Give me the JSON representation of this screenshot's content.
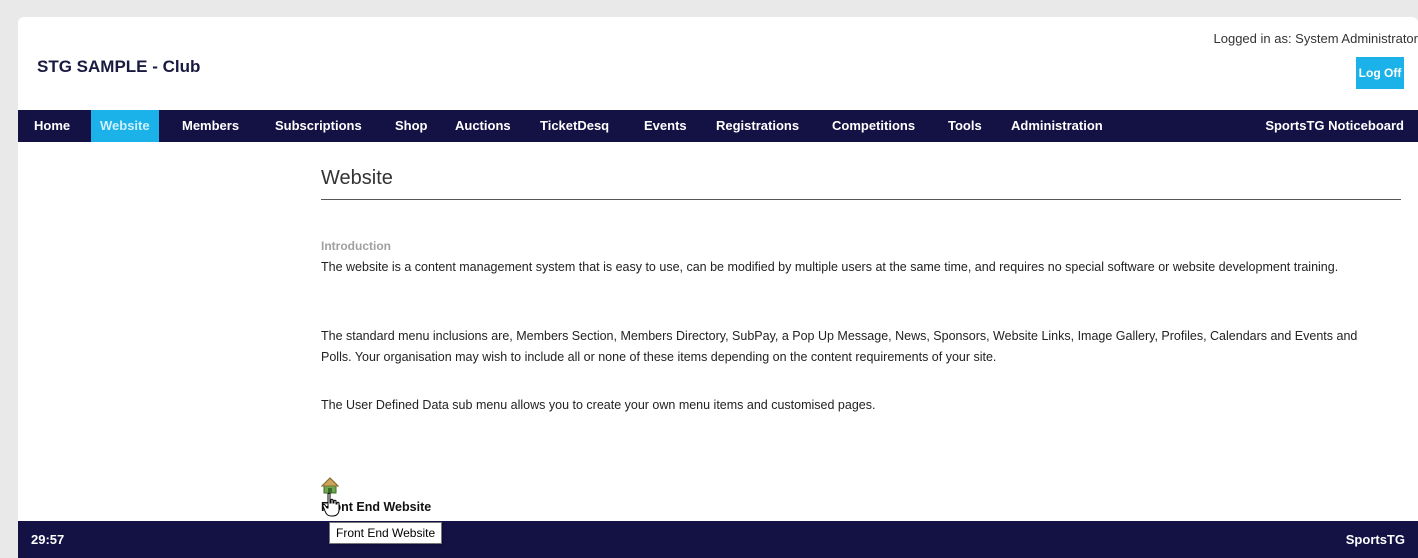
{
  "header": {
    "brand": "STG SAMPLE - Club",
    "login_info": "Logged in as: System Administrator",
    "logoff_label": "Log Off"
  },
  "nav": {
    "items": [
      {
        "label": "Home"
      },
      {
        "label": "Website",
        "active": true
      },
      {
        "label": "Members"
      },
      {
        "label": "Subscriptions"
      },
      {
        "label": "Shop"
      },
      {
        "label": "Auctions"
      },
      {
        "label": "TicketDesq"
      },
      {
        "label": "Events"
      },
      {
        "label": "Registrations"
      },
      {
        "label": "Competitions"
      },
      {
        "label": "Tools"
      },
      {
        "label": "Administration"
      }
    ],
    "noticeboard": "SportsTG Noticeboard"
  },
  "main": {
    "title": "Website",
    "intro_heading": "Introduction",
    "paragraphs": [
      "The website is a content management system that is easy to use, can be modified by multiple users at the same time, and requires no special software or website development training.",
      "The standard menu inclusions are, Members Section, Members Directory, SubPay, a Pop Up Message, News, Sponsors, Website Links, Image Gallery, Profiles, Calendars and Events and Polls. Your organisation may wish to include all or none of these items depending on the content requirements of your site.",
      "The User Defined Data sub menu allows you to create your own menu items and customised pages."
    ],
    "front_end_link": "Front End Website",
    "tooltip": "Front End Website"
  },
  "footer": {
    "left": "29:57",
    "right": "SportsTG"
  },
  "colors": {
    "nav_bg": "#141144",
    "accent": "#1ab2e8"
  },
  "icons": {
    "home": "home-icon",
    "cursor": "hand-cursor-icon"
  }
}
